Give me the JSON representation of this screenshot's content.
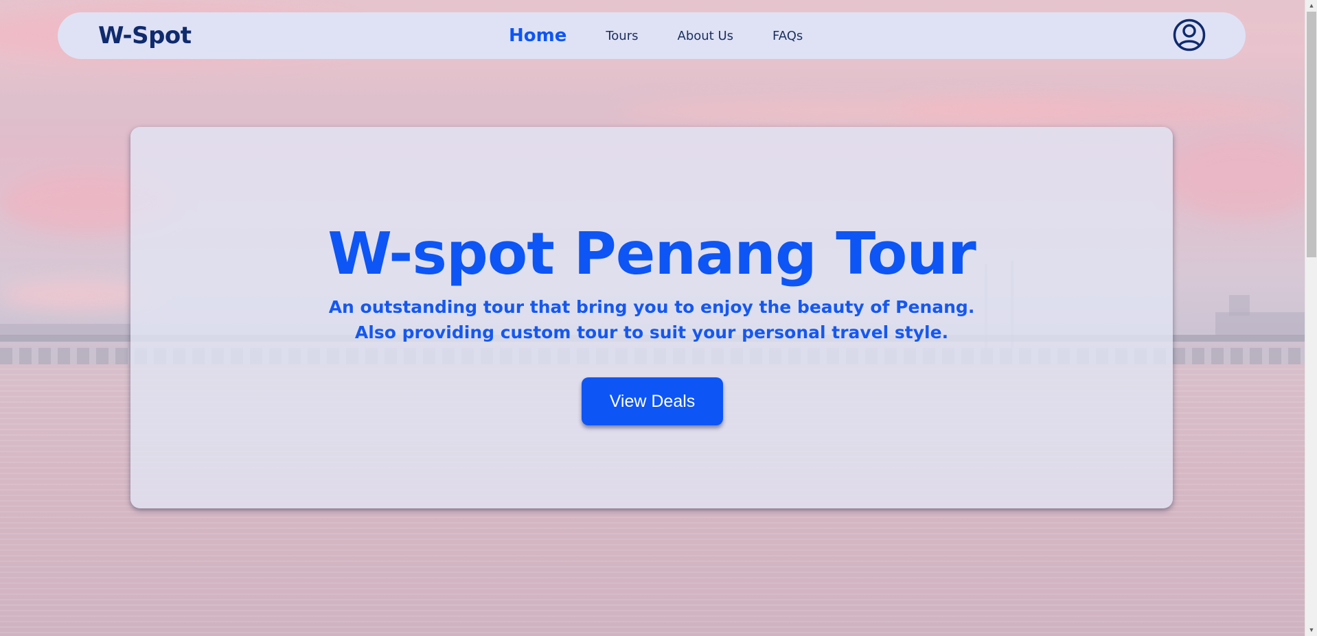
{
  "header": {
    "brand": "W-Spot",
    "nav": [
      {
        "label": "Home",
        "active": true
      },
      {
        "label": "Tours",
        "active": false
      },
      {
        "label": "About Us",
        "active": false
      },
      {
        "label": "FAQs",
        "active": false
      }
    ],
    "account_icon": "user-circle-icon"
  },
  "hero": {
    "title": "W-spot Penang Tour",
    "subtitle_line1": "An outstanding tour that bring you to enjoy the beauty of Penang.",
    "subtitle_line2": "Also providing custom tour to suit your personal travel style.",
    "cta_label": "View Deals"
  },
  "colors": {
    "accent": "#0d55f5",
    "brand_text": "#0f2b6e",
    "navbar_bg": "#dee4f8"
  },
  "scrollbar": {
    "up_icon": "scroll-up-arrow-icon",
    "down_icon": "scroll-down-arrow-icon"
  }
}
